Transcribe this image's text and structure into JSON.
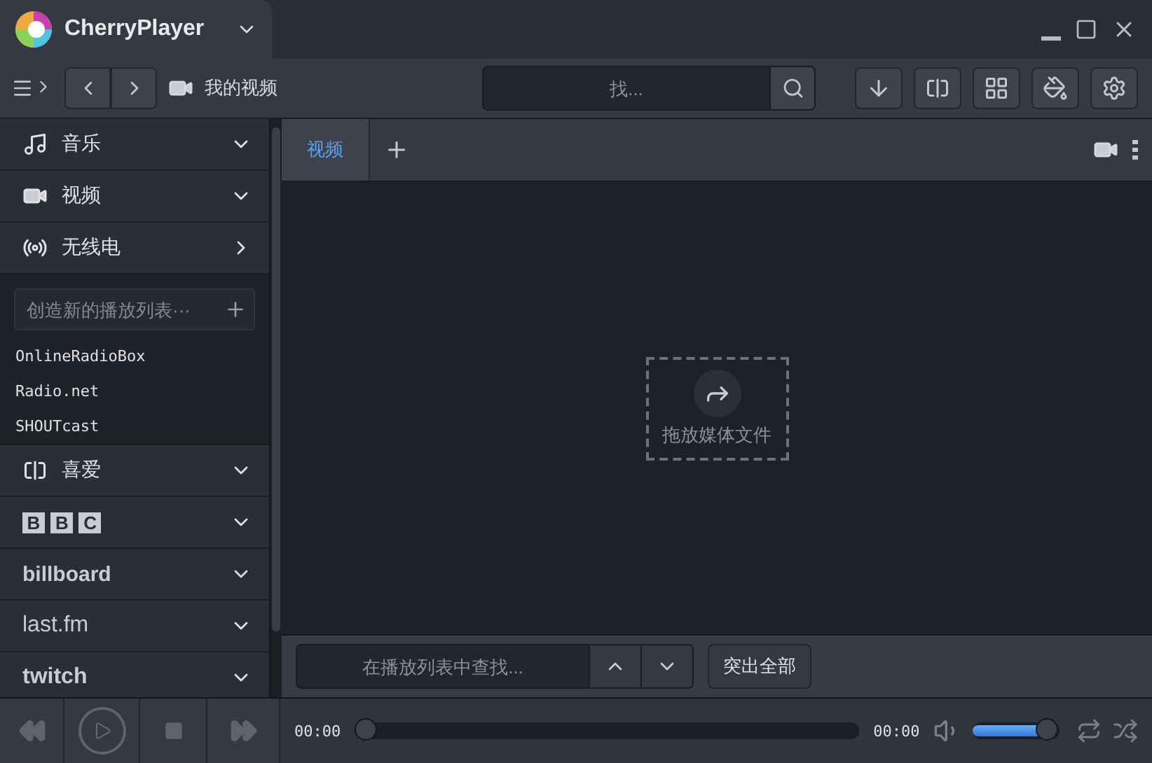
{
  "window": {
    "title": "CherryPlayer"
  },
  "toolbar": {
    "location": "我的视频",
    "search": {
      "placeholder": "找..."
    }
  },
  "sidebar": {
    "items": [
      {
        "label": "音乐",
        "kind": "music",
        "expanded": true
      },
      {
        "label": "视频",
        "kind": "video",
        "expanded": true
      },
      {
        "label": "无线电",
        "kind": "radio",
        "expanded": false
      }
    ],
    "radio_panel": {
      "new_playlist": {
        "placeholder": "创造新的播放列表···"
      },
      "items": [
        "OnlineRadioBox",
        "Radio.net",
        "SHOUTcast"
      ]
    },
    "services": [
      {
        "label": "喜爱",
        "kind": "favorites",
        "expanded": true
      },
      {
        "label": "B B C",
        "kind": "bbc",
        "expanded": true
      },
      {
        "label": "billboard",
        "kind": "billboard",
        "expanded": true
      },
      {
        "label": "last.fm",
        "kind": "lastfm",
        "expanded": true
      },
      {
        "label": "twitch",
        "kind": "twitch",
        "expanded": true
      }
    ]
  },
  "tabs": [
    {
      "label": "视频",
      "selected": true
    }
  ],
  "drop_zone": {
    "label": "拖放媒体文件"
  },
  "playlist_search": {
    "placeholder": "在播放列表中查找...",
    "button": "突出全部"
  },
  "player": {
    "elapsed": "00:00",
    "total": "00:00",
    "progress": {
      "level": 0
    },
    "volume": {
      "level": 0.85
    }
  }
}
